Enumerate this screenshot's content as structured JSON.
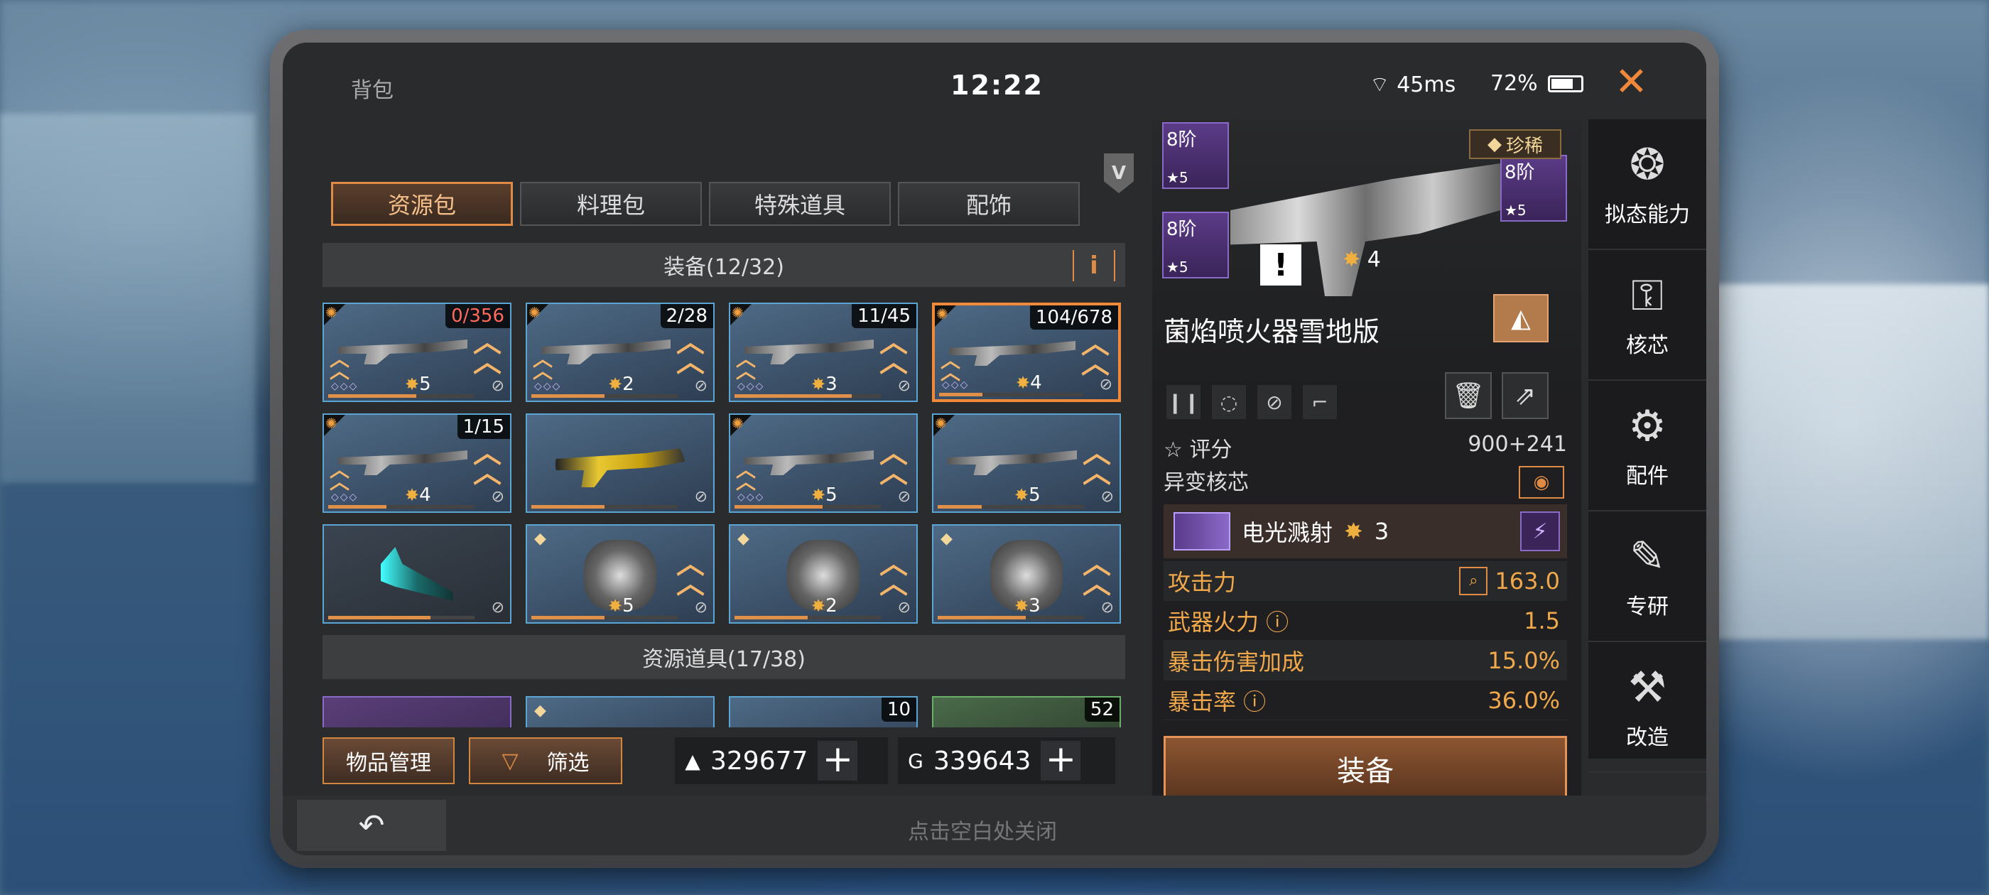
{
  "status": {
    "title": "背包",
    "clock": "12:22",
    "ping": "45ms",
    "battery": "72%",
    "close_icon": "close-icon"
  },
  "tabs": [
    {
      "label": "资源包",
      "active": true
    },
    {
      "label": "料理包",
      "active": false
    },
    {
      "label": "特殊道具",
      "active": false
    },
    {
      "label": "配饰",
      "active": false
    }
  ],
  "sections": {
    "equipment": "装备(12/32)",
    "resources": "资源道具(17/38)",
    "info_label": "i"
  },
  "items": [
    {
      "count": "0/356",
      "red": true,
      "stars": "5",
      "progress": 0.6
    },
    {
      "count": "2/28",
      "red": false,
      "stars": "2",
      "progress": 0.5
    },
    {
      "count": "11/45",
      "red": false,
      "stars": "3",
      "progress": 0.8
    },
    {
      "count": "104/678",
      "red": false,
      "stars": "4",
      "progress": 0.3,
      "selected": true
    },
    {
      "count": "1/15",
      "red": false,
      "stars": "4",
      "progress": 0.4
    },
    {
      "count": "",
      "red": false,
      "stars": "",
      "progress": 0.5
    },
    {
      "count": "",
      "red": false,
      "stars": "5",
      "progress": 0.6
    },
    {
      "count": "",
      "red": false,
      "stars": "5",
      "progress": 0.3
    },
    {
      "count": "",
      "red": false,
      "stars": "",
      "progress": 0.7
    },
    {
      "count": "",
      "red": false,
      "stars": "5",
      "progress": 0.5
    },
    {
      "count": "",
      "red": false,
      "stars": "2",
      "progress": 0.5
    },
    {
      "count": "",
      "red": false,
      "stars": "3",
      "progress": 0.6
    }
  ],
  "partial_counts": [
    "",
    "",
    "10",
    "52"
  ],
  "buttons": {
    "manage": "物品管理",
    "filter": "筛选"
  },
  "currency": {
    "gold": "329677",
    "g": "339643",
    "gold_icon": "▲",
    "g_icon": "G",
    "plus": "+"
  },
  "footer": {
    "back_icon": "↶",
    "hint": "点击空白处关闭"
  },
  "detail": {
    "slots": [
      {
        "level": "8阶",
        "stars": "★5"
      },
      {
        "level": "8阶",
        "stars": "★5"
      },
      {
        "level": "8阶",
        "stars": "★5"
      }
    ],
    "rarity": "珍稀",
    "warn": "!",
    "weapon_stars": "4",
    "weapon_name": "菌焰喷火器雪地版",
    "score_label": "评分",
    "score_value": "900+241",
    "core_header": "异变核芯",
    "core_name": "电光溅射",
    "core_stars": "3",
    "stats": [
      {
        "label": "攻击力",
        "value": "163.0",
        "magnify": true
      },
      {
        "label": "武器火力 ⓘ",
        "value": "1.5"
      },
      {
        "label": "暴击伤害加成",
        "value": "15.0%"
      },
      {
        "label": "暴击率 ⓘ",
        "value": "36.0%"
      }
    ],
    "equip": "装备"
  },
  "sidemenu": [
    {
      "label": "拟态能力"
    },
    {
      "label": "核芯"
    },
    {
      "label": "配件"
    },
    {
      "label": "专研"
    },
    {
      "label": "改造"
    }
  ]
}
